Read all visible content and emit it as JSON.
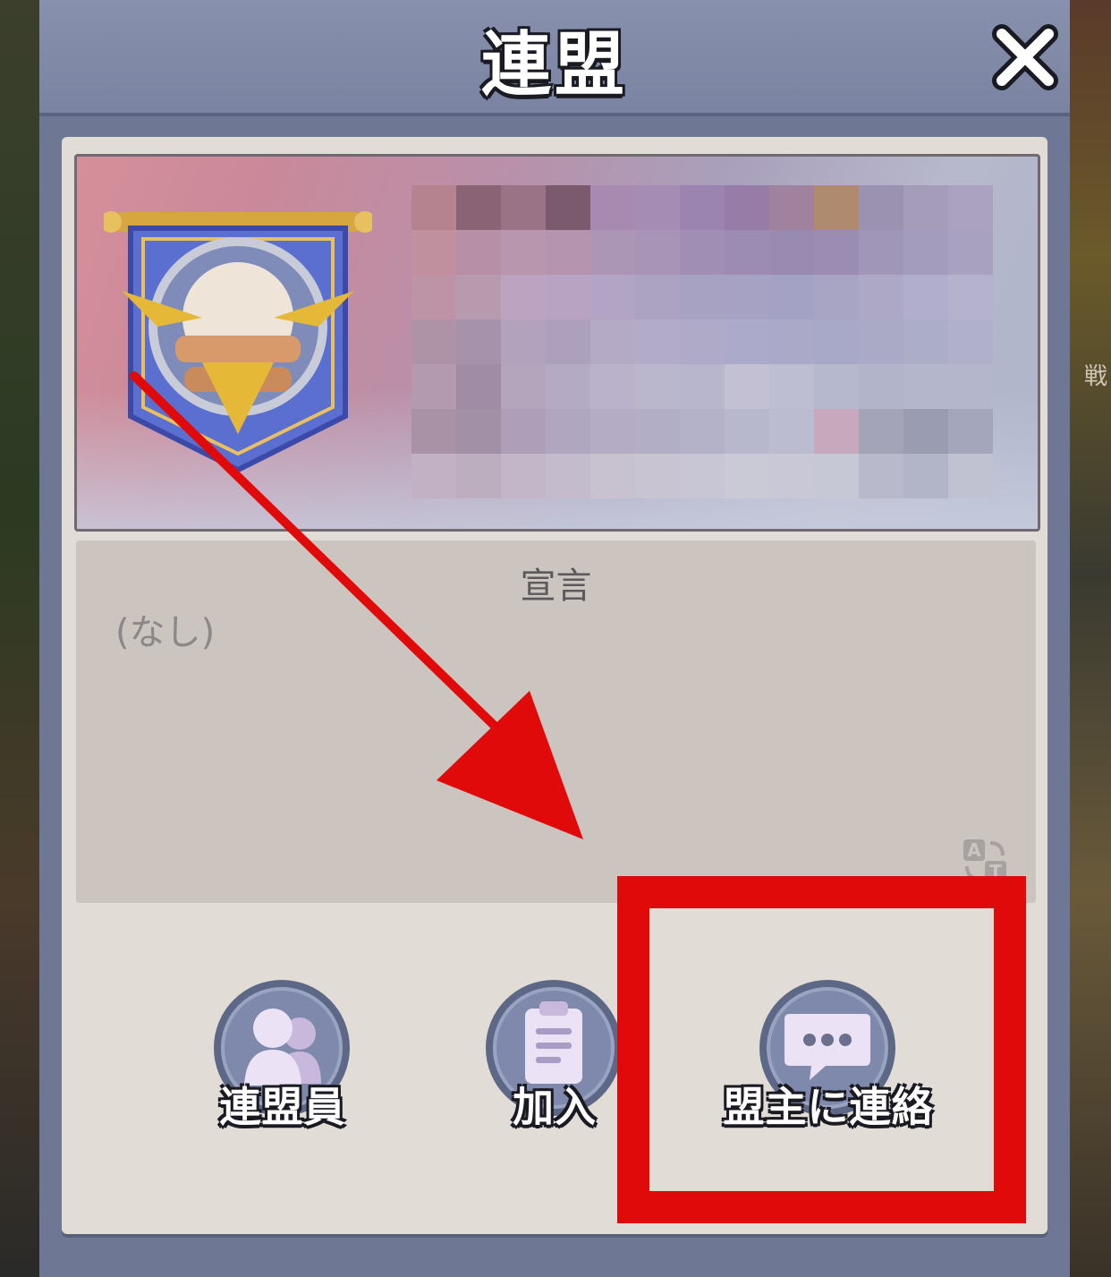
{
  "window": {
    "title": "連盟"
  },
  "declaration": {
    "heading": "宣言",
    "text": "(なし)"
  },
  "actions": [
    {
      "label": "連盟員",
      "icon": "members-icon"
    },
    {
      "label": "加入",
      "icon": "clipboard-icon"
    },
    {
      "label": "盟主に連絡",
      "icon": "chat-bubble-icon"
    }
  ],
  "background": {
    "side_text": "戦"
  },
  "colors": {
    "modal": "#6e7895",
    "panel": "#e2dcd6",
    "annotation_red": "#e00a0a"
  }
}
